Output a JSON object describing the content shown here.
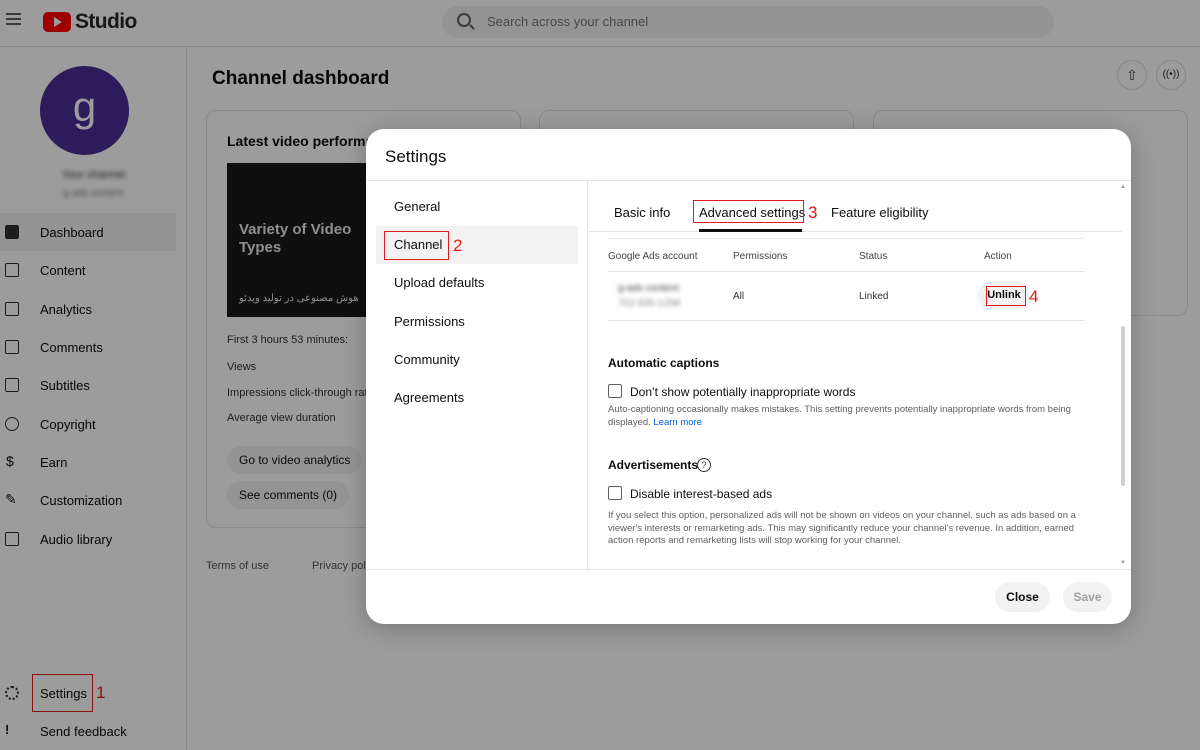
{
  "app": {
    "logo_text": "Studio",
    "search_placeholder": "Search across your channel"
  },
  "sidebar": {
    "avatar_letter": "g",
    "channel_name": "Your channel",
    "channel_sub": "g-ads content",
    "items": [
      {
        "label": "Dashboard",
        "icon": "dashboard-icon"
      },
      {
        "label": "Content",
        "icon": "content-icon"
      },
      {
        "label": "Analytics",
        "icon": "analytics-icon"
      },
      {
        "label": "Comments",
        "icon": "comments-icon"
      },
      {
        "label": "Subtitles",
        "icon": "subtitles-icon"
      },
      {
        "label": "Copyright",
        "icon": "copyright-icon"
      },
      {
        "label": "Earn",
        "icon": "earn-icon"
      },
      {
        "label": "Customization",
        "icon": "customization-icon"
      },
      {
        "label": "Audio library",
        "icon": "audio-library-icon"
      }
    ],
    "settings_label": "Settings",
    "feedback_label": "Send feedback"
  },
  "dashboard": {
    "title": "Channel dashboard",
    "card_title": "Latest video performa",
    "thumb_title": "Variety of Video Types",
    "thumb_caption": "هوش مصنوعی در تولید ویدئو",
    "first_hours": "First 3 hours 53 minutes:",
    "views": "Views",
    "ctr": "Impressions click-through rate",
    "avd": "Average view duration",
    "go_analytics": "Go to video analytics",
    "see_comments": "See comments (0)",
    "terms": "Terms of use",
    "privacy": "Privacy poli"
  },
  "modal": {
    "title": "Settings",
    "menu": [
      "General",
      "Channel",
      "Upload defaults",
      "Permissions",
      "Community",
      "Agreements"
    ],
    "tabs": [
      "Basic info",
      "Advanced settings",
      "Feature eligibility"
    ],
    "table": {
      "headers": [
        "Google Ads account",
        "Permissions",
        "Status",
        "Action"
      ],
      "row": {
        "account_name": "g-ads content",
        "account_id": "702-935-1298",
        "permissions": "All",
        "status": "Linked",
        "action": "Unlink"
      }
    },
    "captions": {
      "title": "Automatic captions",
      "checkbox": "Don’t show potentially inappropriate words",
      "desc": "Auto-captioning occasionally makes mistakes. This setting prevents potentially inappropriate words from being displayed.",
      "learn_more": "Learn more"
    },
    "ads": {
      "title": "Advertisements",
      "checkbox": "Disable interest-based ads",
      "desc": "If you select this option, personalized ads will not be shown on videos on your channel, such as ads based on a viewer's interests or remarketing ads. This may significantly reduce your channel's revenue. In addition, earned action reports and remarketing lists will stop working for your channel."
    },
    "close_label": "Close",
    "save_label": "Save"
  },
  "annotations": [
    "1",
    "2",
    "3",
    "4"
  ],
  "colors": {
    "brand_red": "#ff0000",
    "annotation_red": "#e21b1b",
    "avatar": "#4a2e96",
    "link": "#065fd4"
  }
}
